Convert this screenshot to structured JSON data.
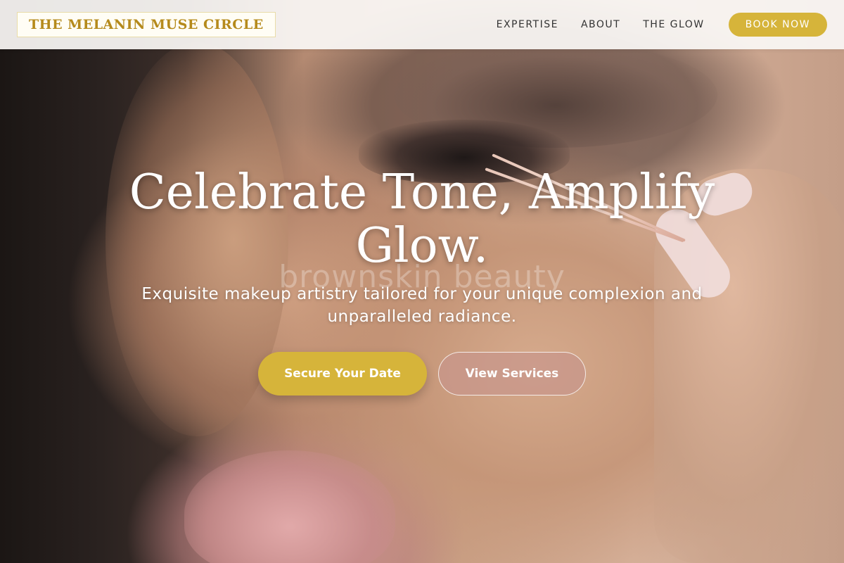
{
  "header": {
    "logo": "THE MELANIN MUSE CIRCLE",
    "nav": [
      {
        "label": "EXPERTISE"
      },
      {
        "label": "ABOUT"
      },
      {
        "label": "THE GLOW"
      }
    ],
    "cta_label": "BOOK NOW"
  },
  "hero": {
    "headline": "Celebrate Tone, Amplify Glow.",
    "watermark": "brownskin beauty",
    "subtext": "Exquisite makeup artistry tailored for your unique complexion and unparalleled radiance.",
    "primary_cta": "Secure Your Date",
    "secondary_cta": "View Services"
  },
  "colors": {
    "accent_gold": "#d6b43a",
    "logo_gold": "#b58a1c"
  }
}
